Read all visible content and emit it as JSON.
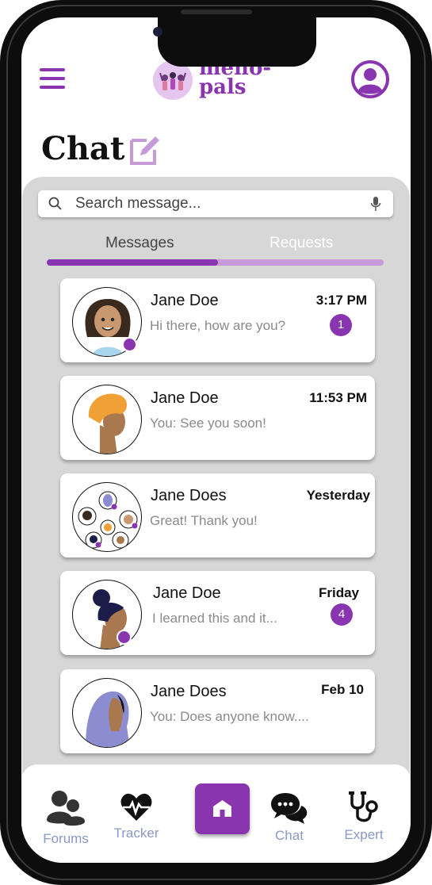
{
  "header": {
    "logo_line1": "meno-",
    "logo_line2": "pals",
    "page_title": "Chat"
  },
  "search": {
    "placeholder": "Search message..."
  },
  "tabs": {
    "messages_label": "Messages",
    "requests_label": "Requests",
    "active": "Messages"
  },
  "conversations": [
    {
      "name": "Jane Doe",
      "preview": "Hi there, how are you?",
      "time": "3:17 PM",
      "unread": "1",
      "online": true,
      "avatar": "woman-curly-hair-avatar"
    },
    {
      "name": "Jane Doe",
      "preview": "You: See you soon!",
      "time": "11:53 PM",
      "unread": "",
      "online": false,
      "avatar": "woman-orange-headwrap-avatar"
    },
    {
      "name": "Jane Does",
      "preview": "Great! Thank you!",
      "time": "Yesterday",
      "unread": "",
      "online": false,
      "avatar": "group-avatar"
    },
    {
      "name": "Jane Doe",
      "preview": "I learned this and it...",
      "time": "Friday",
      "unread": "4",
      "online": true,
      "avatar": "woman-bun-hair-avatar"
    },
    {
      "name": "Jane Does",
      "preview": "You: Does anyone know....",
      "time": "Feb 10",
      "unread": "",
      "online": false,
      "avatar": "woman-hijab-avatar"
    }
  ],
  "nav": {
    "forums": "Forums",
    "tracker": "Tracker",
    "chat": "Chat",
    "expert": "Expert"
  },
  "colors": {
    "accent": "#8a35b0",
    "accent_light": "#c79ad8",
    "panel": "#d7d7d7",
    "nav_label": "#8899c4"
  }
}
